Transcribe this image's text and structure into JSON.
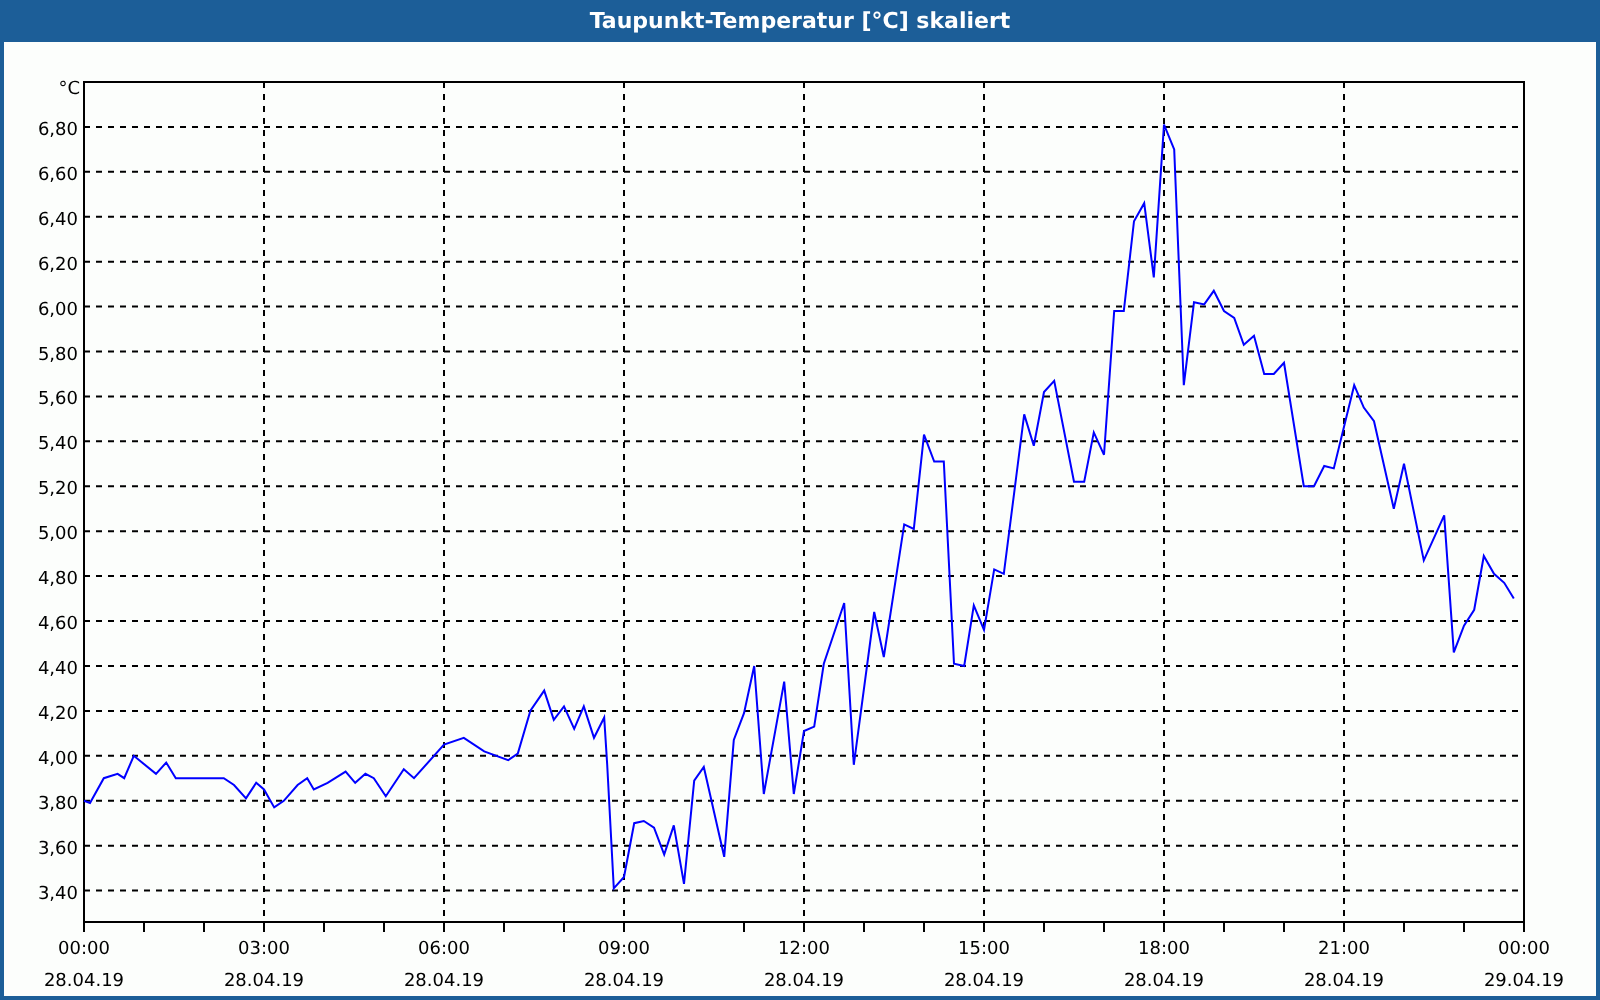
{
  "window": {
    "title": "Taupunkt-Temperatur [°C] skaliert"
  },
  "chart": {
    "date_labels": [
      "28.04.19",
      "28.04.19",
      "28.04.19",
      "28.04.19",
      "28.04.19",
      "28.04.19",
      "28.04.19",
      "28.04.19",
      "29.04.19"
    ],
    "chart_data": {
      "type": "line",
      "ylabel": "°C",
      "grid": true,
      "xlim": [
        0,
        24
      ],
      "ylim": [
        3.26,
        7.0
      ],
      "xticks": [
        {
          "value": 0,
          "label": "00:00"
        },
        {
          "value": 3,
          "label": "03:00"
        },
        {
          "value": 6,
          "label": "06:00"
        },
        {
          "value": 9,
          "label": "09:00"
        },
        {
          "value": 12,
          "label": "12:00"
        },
        {
          "value": 15,
          "label": "15:00"
        },
        {
          "value": 18,
          "label": "18:00"
        },
        {
          "value": 21,
          "label": "21:00"
        },
        {
          "value": 24,
          "label": "00:00"
        }
      ],
      "yticks": [
        {
          "value": 3.4,
          "label": "3,40"
        },
        {
          "value": 3.6,
          "label": "3,60"
        },
        {
          "value": 3.8,
          "label": "3,80"
        },
        {
          "value": 4.0,
          "label": "4,00"
        },
        {
          "value": 4.2,
          "label": "4,20"
        },
        {
          "value": 4.4,
          "label": "4,40"
        },
        {
          "value": 4.6,
          "label": "4,60"
        },
        {
          "value": 4.8,
          "label": "4,80"
        },
        {
          "value": 5.0,
          "label": "5,00"
        },
        {
          "value": 5.2,
          "label": "5,20"
        },
        {
          "value": 5.4,
          "label": "5,40"
        },
        {
          "value": 5.6,
          "label": "5,60"
        },
        {
          "value": 5.8,
          "label": "5,80"
        },
        {
          "value": 6.0,
          "label": "6,00"
        },
        {
          "value": 6.2,
          "label": "6,20"
        },
        {
          "value": 6.4,
          "label": "6,40"
        },
        {
          "value": 6.6,
          "label": "6,60"
        },
        {
          "value": 6.8,
          "label": "6,80"
        }
      ],
      "x": [
        0,
        0.1,
        0.33,
        0.56,
        0.67,
        0.83,
        1.2,
        1.37,
        1.53,
        2.33,
        2.5,
        2.7,
        2.87,
        3.0,
        3.17,
        3.33,
        3.56,
        3.72,
        3.83,
        4.06,
        4.36,
        4.52,
        4.69,
        4.83,
        5.03,
        5.33,
        5.5,
        6.0,
        6.33,
        6.67,
        7.07,
        7.23,
        7.44,
        7.67,
        7.83,
        8.0,
        8.17,
        8.33,
        8.5,
        8.67,
        8.72,
        8.83,
        9.0,
        9.17,
        9.33,
        9.5,
        9.67,
        9.83,
        10.0,
        10.17,
        10.33,
        10.67,
        10.83,
        11.0,
        11.17,
        11.33,
        11.67,
        11.83,
        12.0,
        12.17,
        12.33,
        12.67,
        12.83,
        13.17,
        13.33,
        13.67,
        13.83,
        14.0,
        14.17,
        14.33,
        14.5,
        14.67,
        14.83,
        15.0,
        15.17,
        15.33,
        15.67,
        15.83,
        16.0,
        16.17,
        16.5,
        16.67,
        16.83,
        17.0,
        17.17,
        17.33,
        17.5,
        17.67,
        17.83,
        18.0,
        18.17,
        18.33,
        18.5,
        18.67,
        18.83,
        19.0,
        19.17,
        19.33,
        19.5,
        19.67,
        19.83,
        20.0,
        20.33,
        20.5,
        20.67,
        20.83,
        21.17,
        21.33,
        21.5,
        21.83,
        22.0,
        22.33,
        22.67,
        22.83,
        23.0,
        23.17,
        23.33,
        23.5,
        23.67,
        23.83
      ],
      "series": [
        {
          "color": "#0000ff",
          "values": [
            3.8,
            3.79,
            3.9,
            3.92,
            3.9,
            4.0,
            3.92,
            3.97,
            3.9,
            3.9,
            3.87,
            3.81,
            3.88,
            3.85,
            3.77,
            3.8,
            3.87,
            3.9,
            3.85,
            3.88,
            3.93,
            3.88,
            3.92,
            3.9,
            3.82,
            3.94,
            3.9,
            4.05,
            4.08,
            4.02,
            3.98,
            4.01,
            4.2,
            4.29,
            4.16,
            4.22,
            4.12,
            4.22,
            4.08,
            4.17,
            3.96,
            3.41,
            3.46,
            3.7,
            3.71,
            3.68,
            3.56,
            3.69,
            3.43,
            3.89,
            3.95,
            3.55,
            4.07,
            4.19,
            4.4,
            3.83,
            4.33,
            3.83,
            4.11,
            4.13,
            4.41,
            4.68,
            3.96,
            4.64,
            4.44,
            5.03,
            5.01,
            5.43,
            5.31,
            5.31,
            4.41,
            4.4,
            4.67,
            4.56,
            4.83,
            4.81,
            5.52,
            5.38,
            5.62,
            5.67,
            5.22,
            5.22,
            5.44,
            5.34,
            5.98,
            5.98,
            6.38,
            6.46,
            6.13,
            6.81,
            6.7,
            5.65,
            6.02,
            6.01,
            6.07,
            5.98,
            5.95,
            5.83,
            5.87,
            5.7,
            5.7,
            5.75,
            5.2,
            5.2,
            5.29,
            5.28,
            5.65,
            5.55,
            5.49,
            5.1,
            5.3,
            4.87,
            5.07,
            4.46,
            4.58,
            4.65,
            4.89,
            4.81,
            4.77,
            4.7
          ]
        }
      ]
    }
  }
}
